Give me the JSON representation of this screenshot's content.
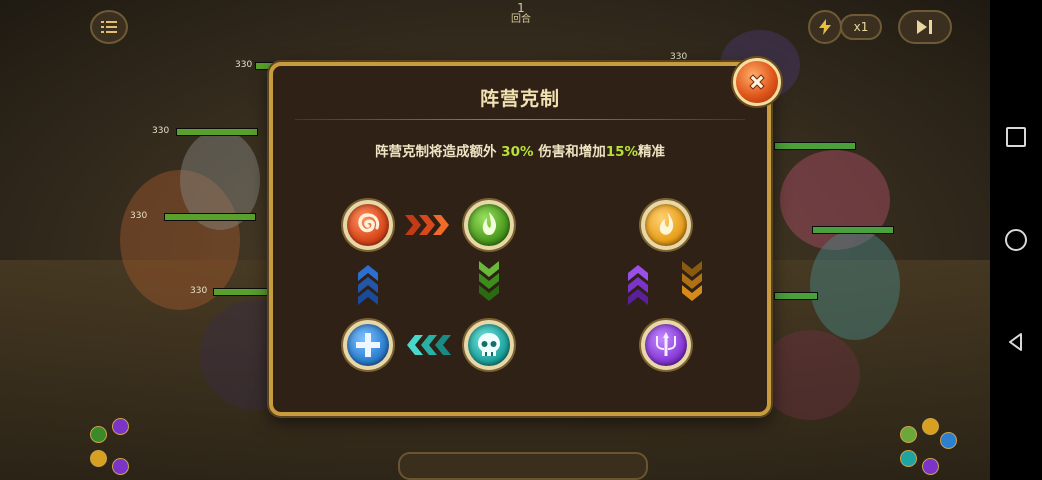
{
  "hud": {
    "turn_number": "1",
    "turn_label": "回合",
    "speed_label": "x1",
    "hp_values": [
      "330",
      "330",
      "330",
      "330",
      "330",
      "330"
    ]
  },
  "dialog": {
    "title": "阵营克制",
    "desc_part1": "阵营克制将造成额外 ",
    "desc_damage_pct": "30%",
    "desc_part2": " 伤害和增加",
    "desc_accuracy_pct": "15%",
    "desc_part3": "精准",
    "highlight_color": "#b6e23a"
  },
  "factions": [
    {
      "icon": "fire-swirl-icon",
      "color": "#d9481c"
    },
    {
      "icon": "leaf-flame-icon",
      "color": "#4a9a1e"
    },
    {
      "icon": "cross-icon",
      "color": "#2d7fd0"
    },
    {
      "icon": "skull-icon",
      "color": "#1fa5a0"
    },
    {
      "icon": "light-flame-icon",
      "color": "#e8a01c"
    },
    {
      "icon": "trident-icon",
      "color": "#8a3ad8"
    }
  ],
  "relations": [
    {
      "from": "fire",
      "to": "nature",
      "color": "#d2471d"
    },
    {
      "from": "fire",
      "to": "water",
      "color": "#2d6fd0"
    },
    {
      "from": "nature",
      "to": "undead",
      "color": "#3d8d1c"
    },
    {
      "from": "undead",
      "to": "water",
      "color": "#27b0a6"
    },
    {
      "from": "light",
      "to": "dark",
      "color": "#7a34c8"
    },
    {
      "from": "dark",
      "to": "light",
      "color": "#d68a18"
    }
  ]
}
